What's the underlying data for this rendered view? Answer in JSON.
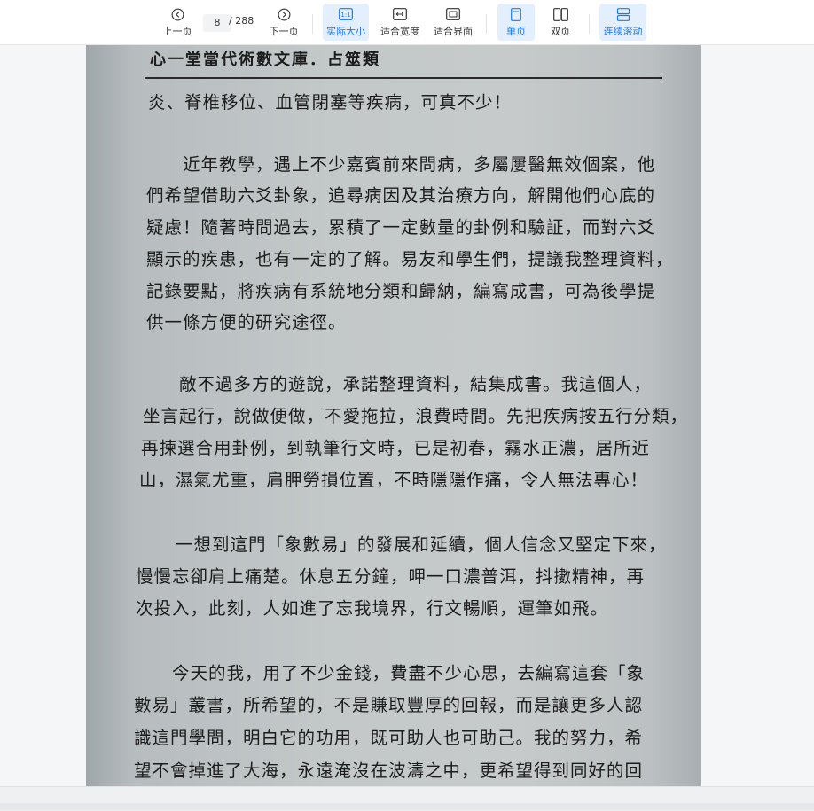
{
  "toolbar": {
    "prev_label": "上一页",
    "current_page": "8",
    "total_pages": "/ 288",
    "next_label": "下一页",
    "actual_size_label": "实际大小",
    "fit_width_label": "适合宽度",
    "fit_page_label": "适合界面",
    "single_page_label": "单页",
    "double_page_label": "双页",
    "continuous_label": "连续滚动",
    "actual_size_icon_text": "1:1"
  },
  "colors": {
    "accent": "#1e7be0",
    "active_bg": "#e3effc"
  },
  "icons": [
    "chevron-left-circle-icon",
    "chevron-right-circle-icon",
    "actual-size-icon",
    "fit-width-icon",
    "fit-page-icon",
    "single-page-icon",
    "double-page-icon",
    "continuous-scroll-icon"
  ],
  "document": {
    "header": "心一堂當代術數文庫．占筮類",
    "lines": [
      "炎、脊椎移位、血管閉塞等疾病，可真不少！",
      "　　近年教學，遇上不少嘉賓前來問病，多屬屢醫無效個案，他",
      "們希望借助六爻卦象，追尋病因及其治療方向，解開他們心底的",
      "疑慮！隨著時間過去，累積了一定數量的卦例和驗証，而對六爻",
      "顯示的疾患，也有一定的了解。易友和學生們，提議我整理資料，",
      "記錄要點，將疾病有系統地分類和歸納，編寫成書，可為後學提",
      "供一條方便的研究途徑。",
      "　　敵不過多方的遊說，承諾整理資料，結集成書。我這個人，",
      "坐言起行，說做便做，不愛拖拉，浪費時間。先把疾病按五行分類，",
      "再揀選合用卦例，到執筆行文時，已是初春，霧水正濃，居所近",
      "山，濕氣尤重，肩胛勞損位置，不時隱隱作痛，令人無法專心！",
      "　　一想到這門「象數易」的發展和延續，個人信念又堅定下來，",
      "慢慢忘卻肩上痛楚。休息五分鐘，呷一口濃普洱，抖擻精神，再",
      "次投入，此刻，人如進了忘我境界，行文暢順，運筆如飛。",
      "　　今天的我，用了不少金錢，費盡不少心思，去編寫這套「象",
      "數易」叢書，所希望的，不是賺取豐厚的回報，而是讓更多人認",
      "識這門學問，明白它的功用，既可助人也可助己。我的努力，希",
      "望不會掉進了大海，永遠淹沒在波濤之中，更希望得到同好的回"
    ]
  }
}
